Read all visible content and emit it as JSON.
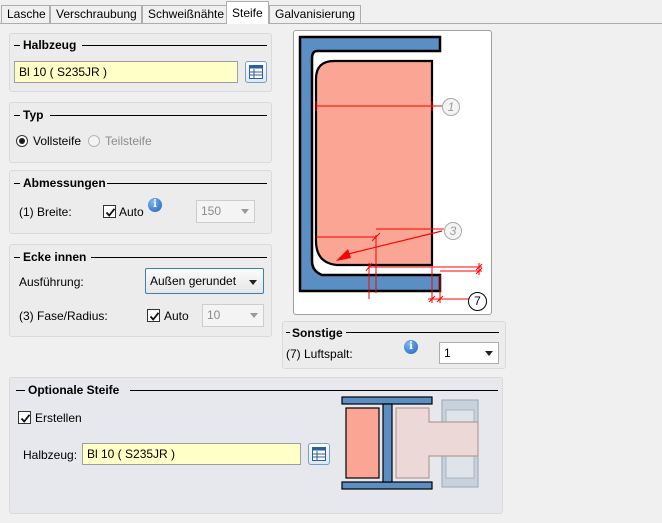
{
  "tabs": [
    {
      "label": "Lasche"
    },
    {
      "label": "Verschraubung"
    },
    {
      "label": "Schweißnähte"
    },
    {
      "label": "Steife"
    },
    {
      "label": "Galvanisierung"
    }
  ],
  "active_tab": "Steife",
  "halbzeug": {
    "title": "Halbzeug",
    "value": "Bl 10  ( S235JR )"
  },
  "typ": {
    "title": "Typ",
    "options": [
      {
        "label": "Vollsteife",
        "selected": true,
        "enabled": true
      },
      {
        "label": "Teilsteife",
        "selected": false,
        "enabled": false
      }
    ]
  },
  "abmessungen": {
    "title": "Abmessungen",
    "breite_label": "(1) Breite:",
    "auto_label": "Auto",
    "auto_checked": true,
    "breite_value": "150"
  },
  "ecke_innen": {
    "title": "Ecke innen",
    "ausfuehrung_label": "Ausführung:",
    "ausfuehrung_value": "Außen gerundet",
    "fase_label": "(3) Fase/Radius:",
    "auto_label": "Auto",
    "auto_checked": true,
    "fase_value": "10"
  },
  "sonstige": {
    "title": "Sonstige",
    "luftspalt_label": "(7) Luftspalt:",
    "luftspalt_value": "1"
  },
  "optionale_steife": {
    "title": "Optionale Steife",
    "erstellen_label": "Erstellen",
    "erstellen_checked": true,
    "halbzeug_label": "Halbzeug:",
    "halbzeug_value": "Bl 10  ( S235JR )"
  },
  "diagram": {
    "markers": [
      "1",
      "3",
      "7"
    ]
  },
  "colors": {
    "steel_blue": "#5b8fc4",
    "stiffener_salmon": "#fba595",
    "dimension_red": "#ff0000",
    "field_yellow": "#ffffc8"
  }
}
